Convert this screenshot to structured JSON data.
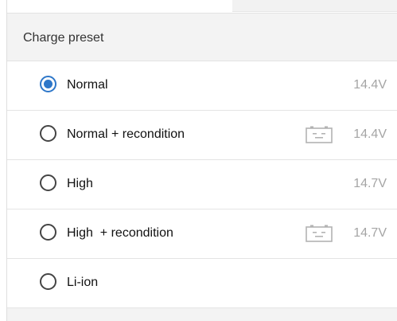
{
  "section": {
    "title": "Charge preset"
  },
  "options": [
    {
      "label": "Normal",
      "voltage": "14.4V",
      "selected": true,
      "icon": null
    },
    {
      "label": "Normal + recondition",
      "voltage": "14.4V",
      "selected": false,
      "icon": "battery-icon"
    },
    {
      "label": "High",
      "voltage": "14.7V",
      "selected": false,
      "icon": null
    },
    {
      "label": "High  + recondition",
      "voltage": "14.7V",
      "selected": false,
      "icon": "battery-icon"
    },
    {
      "label": "Li-ion",
      "voltage": "",
      "selected": false,
      "icon": null
    }
  ],
  "colors": {
    "accent": "#2e77c9",
    "muted_text": "#a5a5a5",
    "header_bg": "#f3f3f3"
  }
}
